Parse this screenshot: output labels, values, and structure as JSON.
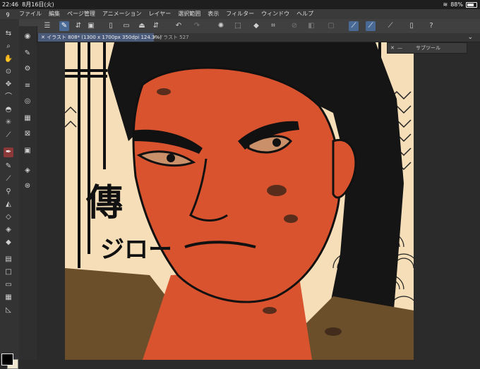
{
  "status": {
    "time": "22:46",
    "date": "8月16日(火)",
    "battery": "88%"
  },
  "menu": {
    "items": [
      "ファイル",
      "編集",
      "ページ管理",
      "アニメーション",
      "レイヤー",
      "選択範囲",
      "表示",
      "フィルター",
      "ウィンドウ",
      "ヘルプ"
    ]
  },
  "tabs": {
    "active": "イラスト 808* (1300 x 1700px 350dpi 124.3%)",
    "inactive": "イラスト 527"
  },
  "subtool": {
    "title": "サブツール"
  },
  "artwork": {
    "calligraphy_main": "傳",
    "calligraphy_sub": "ジロー"
  },
  "colors": {
    "main": "#000000",
    "sub": "#f0e6d0",
    "accent": "#4a6a96",
    "skin": "#d9532f",
    "background": "#f6dfb8"
  }
}
